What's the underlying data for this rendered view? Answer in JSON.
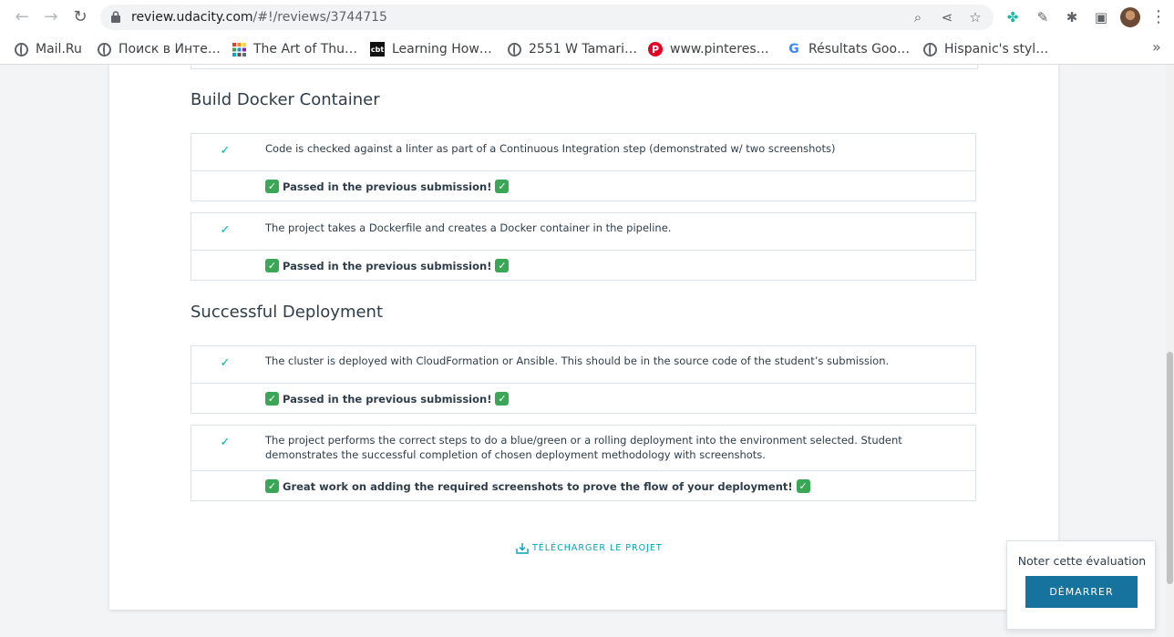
{
  "browser": {
    "url_host": "review.udacity.com",
    "url_path": "/#!/reviews/3744715",
    "bookmarks": [
      {
        "label": "Mail.Ru",
        "icon": "globe-icon"
      },
      {
        "label": "Поиск в Инте…",
        "icon": "globe-icon"
      },
      {
        "label": "The Art of Thu…",
        "icon": "grid-icon"
      },
      {
        "label": "Learning How…",
        "icon": "cbt-icon"
      },
      {
        "label": "2551 W Tamari…",
        "icon": "globe-icon"
      },
      {
        "label": "www.pinteres…",
        "icon": "pinterest-icon"
      },
      {
        "label": "Résultats Goo…",
        "icon": "google-icon"
      },
      {
        "label": "Hispanic's styl…",
        "icon": "globe-icon"
      }
    ]
  },
  "sections": [
    {
      "title": "Build Docker Container",
      "criteria": [
        {
          "text": "Code is checked against a linter as part of a Continuous Integration step (demonstrated w/ two screenshots)",
          "note": "Passed in the previous submission!"
        },
        {
          "text": "The project takes a Dockerfile and creates a Docker container in the pipeline.",
          "note": "Passed in the previous submission!"
        }
      ]
    },
    {
      "title": "Successful Deployment",
      "criteria": [
        {
          "text": "The cluster is deployed with CloudFormation or Ansible. This should be in the source code of the student’s submission.",
          "note": "Passed in the previous submission!"
        },
        {
          "text": "The project performs the correct steps to do a blue/green or a rolling deployment into the environment selected. Student demonstrates the successful completion of chosen deployment methodology with screenshots.",
          "note": "Great work on adding the required screenshots to prove the flow of your deployment!"
        }
      ]
    }
  ],
  "download_label": "TÉLÉCHARGER LE PROJET",
  "rating": {
    "label": "Noter cette évaluation",
    "button": "DÉMARRER"
  },
  "colors": {
    "accent": "#02b3a1",
    "button": "#15739e",
    "link": "#02a3b8",
    "emoji_check": "#3aa757"
  }
}
